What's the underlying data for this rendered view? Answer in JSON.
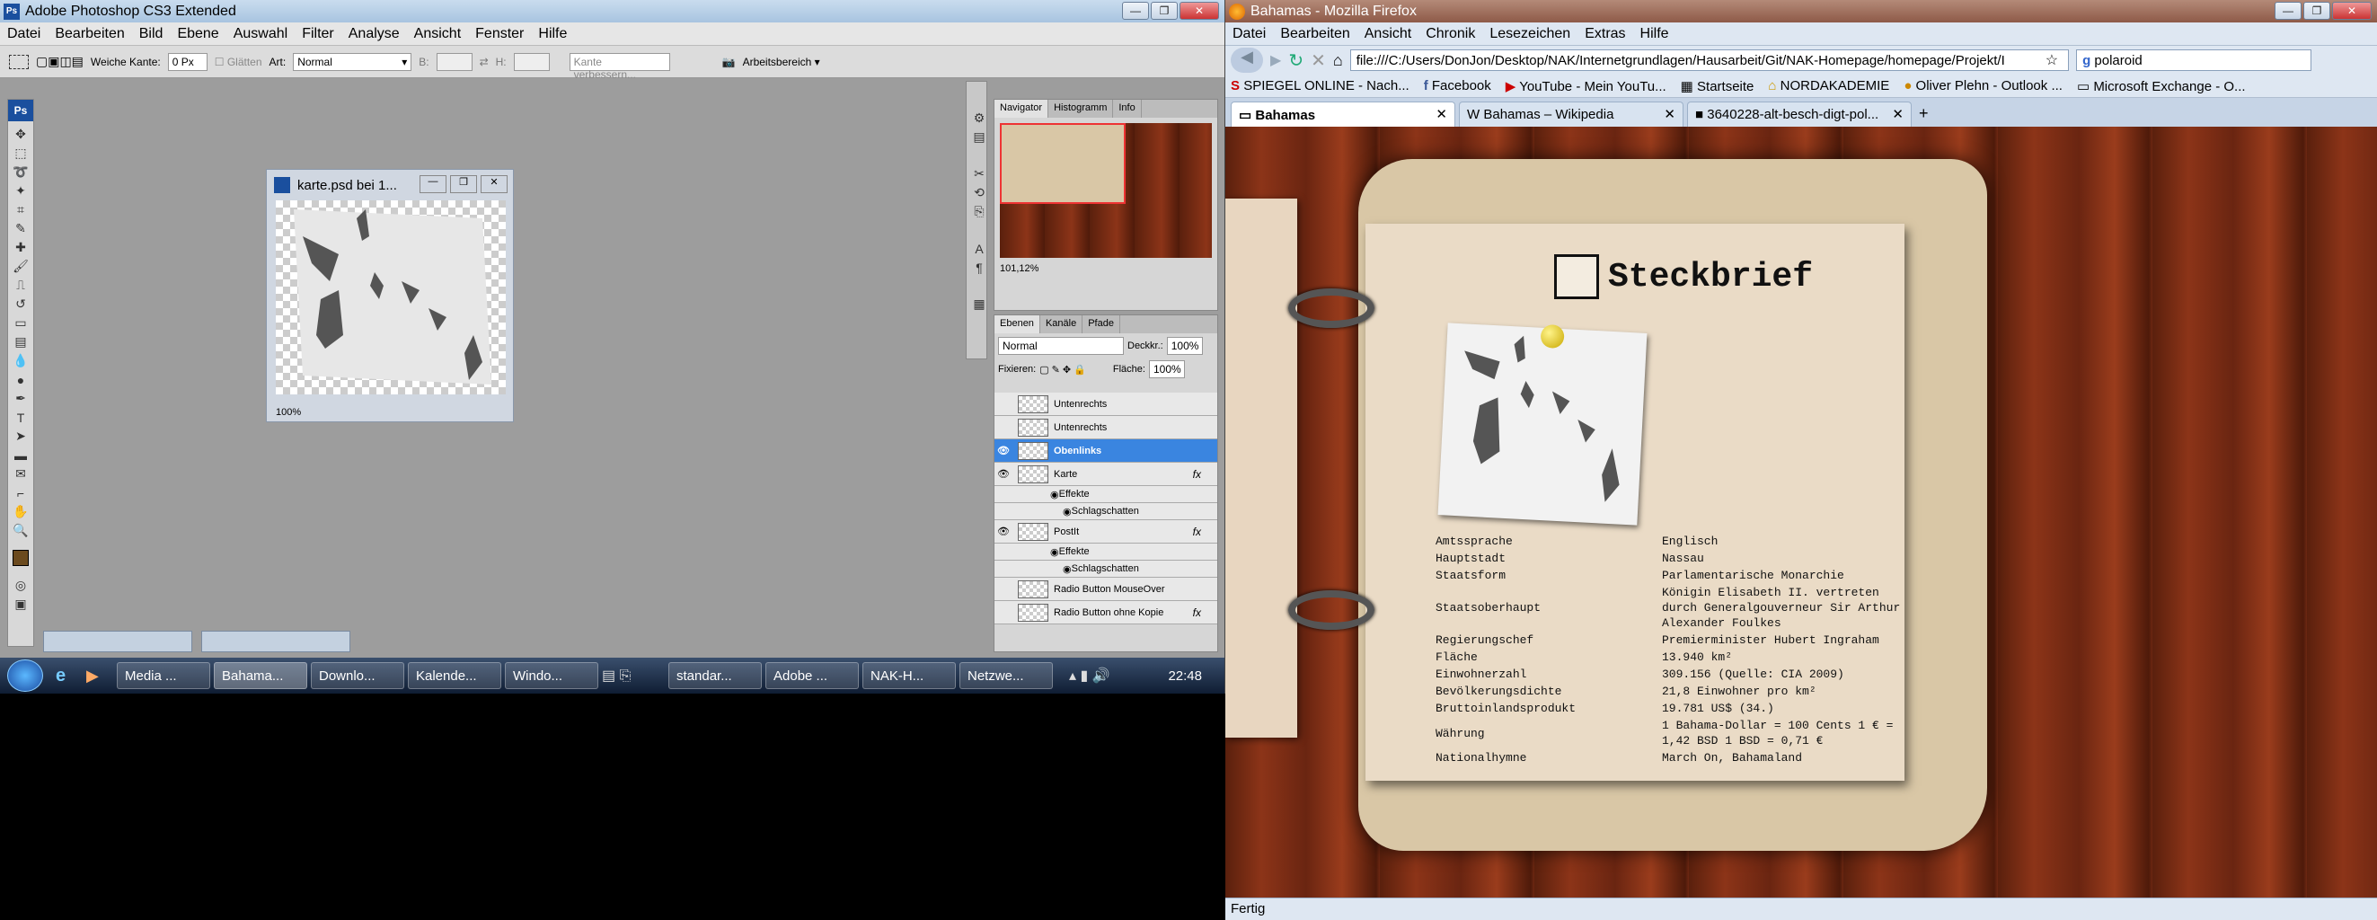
{
  "photoshop": {
    "title": "Adobe Photoshop CS3 Extended",
    "menu": [
      "Datei",
      "Bearbeiten",
      "Bild",
      "Ebene",
      "Auswahl",
      "Filter",
      "Analyse",
      "Ansicht",
      "Fenster",
      "Hilfe"
    ],
    "options": {
      "feather_label": "Weiche Kante:",
      "feather_value": "0 Px",
      "antialias_label": "Glätten",
      "style_label": "Art:",
      "style_value": "Normal",
      "width_label": "B:",
      "height_label": "H:",
      "refine_edge": "Kante verbessern...",
      "workspace": "Arbeitsbereich"
    },
    "document": {
      "title": "karte.psd bei 1...",
      "zoom": "100%"
    },
    "navigator": {
      "tabs": [
        "Navigator",
        "Histogramm",
        "Info"
      ],
      "zoom": "101,12%"
    },
    "layers_panel": {
      "tabs": [
        "Ebenen",
        "Kanäle",
        "Pfade"
      ],
      "blend_mode": "Normal",
      "opacity_label": "Deckkr.:",
      "opacity": "100%",
      "lock_label": "Fixieren:",
      "fill_label": "Fläche:",
      "fill": "100%",
      "layers": [
        {
          "name": "Untenrechts",
          "type": "layer",
          "visible": false,
          "fx": false
        },
        {
          "name": "Untenrechts",
          "type": "layer",
          "visible": false,
          "fx": false
        },
        {
          "name": "Obenlinks",
          "type": "layer",
          "visible": true,
          "fx": false,
          "selected": true
        },
        {
          "name": "Karte",
          "type": "layer",
          "visible": true,
          "fx": true
        },
        {
          "name": "Effekte",
          "type": "sub",
          "visible": true
        },
        {
          "name": "Schlagschatten",
          "type": "sub2",
          "visible": true
        },
        {
          "name": "PostIt",
          "type": "layer",
          "visible": true,
          "fx": true
        },
        {
          "name": "Effekte",
          "type": "sub",
          "visible": true
        },
        {
          "name": "Schlagschatten",
          "type": "sub2",
          "visible": true
        },
        {
          "name": "Radio Button MouseOver",
          "type": "layer",
          "visible": false,
          "fx": false
        },
        {
          "name": "Radio Button ohne Kopie",
          "type": "layer",
          "visible": false,
          "fx": true
        }
      ]
    }
  },
  "taskbar": {
    "items": [
      "Media ...",
      "Bahama...",
      "Downlo...",
      "Kalende...",
      "Windo...",
      "standar...",
      "Adobe ...",
      "NAK-H...",
      "Netzwe..."
    ],
    "active_index": 1,
    "clock": "22:48"
  },
  "firefox": {
    "title": "Bahamas - Mozilla Firefox",
    "menu": [
      "Datei",
      "Bearbeiten",
      "Ansicht",
      "Chronik",
      "Lesezeichen",
      "Extras",
      "Hilfe"
    ],
    "url": "file:///C:/Users/DonJon/Desktop/NAK/Internetgrundlagen/Hausarbeit/Git/NAK-Homepage/homepage/Projekt/I",
    "search": "polaroid",
    "bookmarks": [
      "SPIEGEL ONLINE - Nach...",
      "Facebook",
      "YouTube - Mein YouTu...",
      "Startseite",
      "NORDAKADEMIE",
      "Oliver Plehn - Outlook ...",
      "Microsoft Exchange - O..."
    ],
    "tabs": [
      "Bahamas",
      "Bahamas – Wikipedia",
      "3640228-alt-besch-digt-pol..."
    ],
    "status": "Fertig",
    "page": {
      "heading": "Steckbrief",
      "facts": [
        {
          "k": "Amtssprache",
          "v": "Englisch"
        },
        {
          "k": "Hauptstadt",
          "v": "Nassau"
        },
        {
          "k": "Staatsform",
          "v": "Parlamentarische Monarchie"
        },
        {
          "k": "Staatsoberhaupt",
          "v": "Königin Elisabeth II. vertreten durch Generalgouverneur Sir Arthur Alexander Foulkes"
        },
        {
          "k": "Regierungschef",
          "v": "Premierminister Hubert Ingraham"
        },
        {
          "k": "Fläche",
          "v": "13.940 km²"
        },
        {
          "k": "Einwohnerzahl",
          "v": "309.156 (Quelle: CIA 2009)"
        },
        {
          "k": "Bevölkerungsdichte",
          "v": "21,8 Einwohner pro km²"
        },
        {
          "k": "Bruttoinlandsprodukt",
          "v": "19.781 US$ (34.)"
        },
        {
          "k": "Währung",
          "v": "1 Bahama-Dollar = 100 Cents 1 € = 1,42 BSD 1 BSD = 0,71 €"
        },
        {
          "k": "Nationalhymne",
          "v": "March On, Bahamaland"
        }
      ]
    }
  }
}
